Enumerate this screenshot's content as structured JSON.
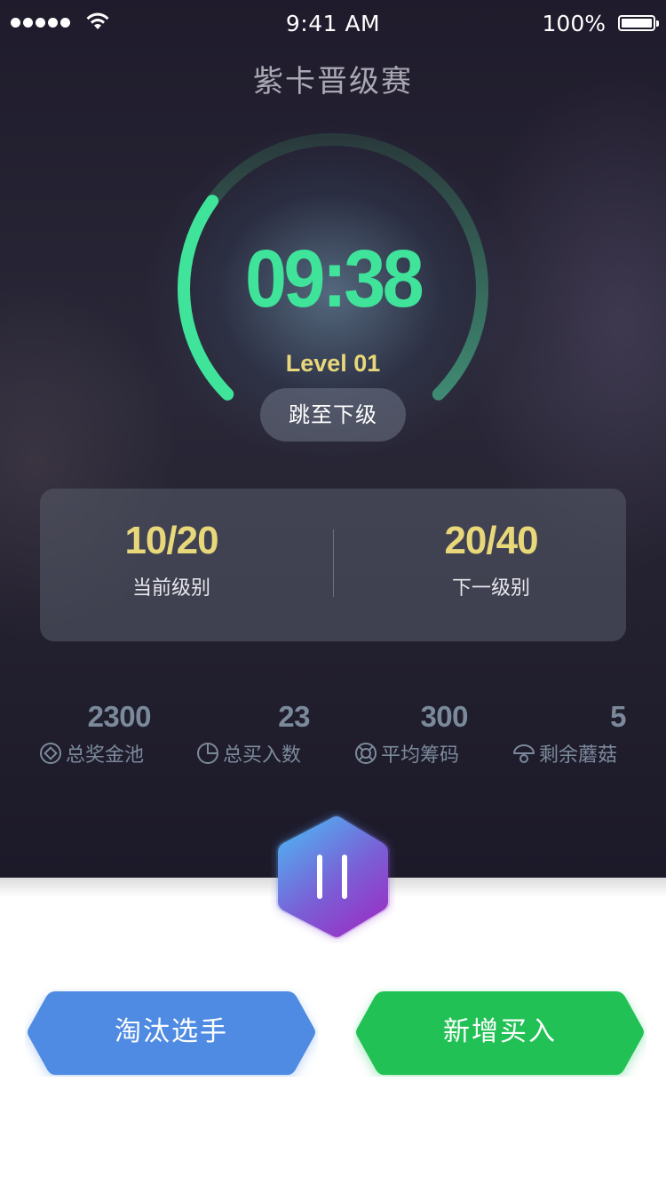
{
  "status_bar": {
    "time": "9:41 AM",
    "battery": "100%"
  },
  "header": {
    "title": "紫卡晋级赛"
  },
  "timer": {
    "countdown": "09:38",
    "level": "Level 01",
    "jump_label": "跳至下级",
    "progress": 0.3,
    "color": "#3fe39a"
  },
  "levels": {
    "current": {
      "value": "10/20",
      "label": "当前级别"
    },
    "next": {
      "value": "20/40",
      "label": "下一级别"
    }
  },
  "stats": [
    {
      "value": "2300",
      "label": "总奖金池",
      "icon": "prize-pool-icon"
    },
    {
      "value": "23",
      "label": "总买入数",
      "icon": "pie-chart-icon"
    },
    {
      "value": "300",
      "label": "平均筹码",
      "icon": "chip-icon"
    },
    {
      "value": "5",
      "label": "剩余蘑菇",
      "icon": "mushroom-icon"
    }
  ],
  "controls": {
    "pause_icon": "pause-icon"
  },
  "actions": {
    "eliminate": {
      "label": "淘汰选手",
      "color": "#508be2"
    },
    "add_buyin": {
      "label": "新增买入",
      "color": "#21c155"
    }
  }
}
